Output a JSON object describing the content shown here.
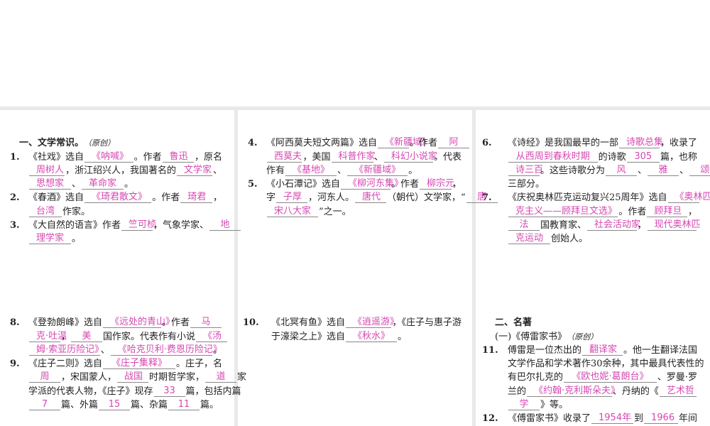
{
  "accent_color": "#d548b2",
  "panels": [
    {
      "lines": [
        [
          {
            "t": "一、文学常识。",
            "h": 1
          },
          {
            "t": "（原创）",
            "i": 1
          }
        ],
        [
          {
            "t": "1.",
            "n": 1
          },
          {
            "t": "《社戏》选自"
          },
          {
            "t": "《呐喊》",
            "b": 1
          },
          {
            "t": "。作者"
          },
          {
            "t": "鲁迅",
            "b": 1
          },
          {
            "t": "，原名"
          }
        ],
        [
          {
            "t": "周树人",
            "b": 1
          },
          {
            "t": "，浙江绍兴人，我国著名的"
          },
          {
            "t": "文学家",
            "b": 1
          },
          {
            "t": "、"
          }
        ],
        [
          {
            "t": "思想家",
            "b": 1
          },
          {
            "t": "、"
          },
          {
            "t": "革命家",
            "b": 1
          },
          {
            "t": "。"
          }
        ],
        [
          {
            "t": "2.",
            "n": 1
          },
          {
            "t": "《春酒》选自"
          },
          {
            "t": "《琦君散文》",
            "b": 1
          },
          {
            "t": "。作者"
          },
          {
            "t": "琦君",
            "b": 1
          },
          {
            "t": "，"
          }
        ],
        [
          {
            "t": "台湾",
            "b": 1
          },
          {
            "t": "作家。"
          }
        ],
        [
          {
            "t": "3.",
            "n": 1
          },
          {
            "t": "《大自然的语言》作者"
          },
          {
            "t": "竺可桢",
            "b": 1
          },
          {
            "t": "，气象学家、"
          },
          {
            "t": "地",
            "b": 1
          }
        ],
        [
          {
            "t": "理学家",
            "b": 1
          },
          {
            "t": "。"
          }
        ]
      ]
    },
    {
      "lines": [
        [
          {
            "t": "4.",
            "n": 1
          },
          {
            "t": "《阿西莫夫短文两篇》选自"
          },
          {
            "t": "《新疆域》",
            "b": 1
          },
          {
            "t": "。作者"
          },
          {
            "t": "阿",
            "b": 1
          }
        ],
        [
          {
            "t": "西莫夫",
            "b": 1
          },
          {
            "t": "，美国"
          },
          {
            "t": "科普作家",
            "b": 1
          },
          {
            "t": "、"
          },
          {
            "t": "科幻小说家",
            "b": 1
          },
          {
            "t": "。代表"
          }
        ],
        [
          {
            "t": "作有"
          },
          {
            "t": "《基地》",
            "b": 1
          },
          {
            "t": "、"
          },
          {
            "t": "《新疆域》",
            "b": 1
          },
          {
            "t": "。"
          }
        ],
        [
          {
            "t": "5.",
            "n": 1
          },
          {
            "t": "《小石潭记》选自"
          },
          {
            "t": "《柳河东集》",
            "b": 1
          },
          {
            "t": "。作者"
          },
          {
            "t": "柳宗元",
            "b": 1
          },
          {
            "t": "，"
          }
        ],
        [
          {
            "t": "字"
          },
          {
            "t": "子厚",
            "b": 1
          },
          {
            "t": "，河东人。"
          },
          {
            "t": "唐代",
            "b": 1
          },
          {
            "t": "（朝代）文学家，“"
          },
          {
            "t": "唐",
            "b": 1
          }
        ],
        [
          {
            "t": "宋八大家",
            "b": 1
          },
          {
            "t": "”之一。"
          }
        ]
      ]
    },
    {
      "lines": [
        [
          {
            "t": "6.",
            "n": 1
          },
          {
            "t": "《诗经》是我国最早的一部"
          },
          {
            "t": "诗歌总集",
            "b": 1
          },
          {
            "t": "，收录了"
          }
        ],
        [
          {
            "t": "从西周到春秋时期",
            "b": 1
          },
          {
            "t": "的诗歌"
          },
          {
            "t": "305",
            "b": 1
          },
          {
            "t": "篇，也称"
          }
        ],
        [
          {
            "t": "诗三百",
            "b": 1
          },
          {
            "t": "。这些诗歌分为"
          },
          {
            "t": "风",
            "b": 1
          },
          {
            "t": "、"
          },
          {
            "t": "雅",
            "b": 1
          },
          {
            "t": "、"
          },
          {
            "t": "颂",
            "b": 1
          }
        ],
        [
          {
            "t": "三部分。"
          }
        ],
        [
          {
            "t": "7.",
            "n": 1
          },
          {
            "t": "《庆祝奥林匹克运动复兴25周年》选自"
          },
          {
            "t": "《奥林匹",
            "b": 1
          }
        ],
        [
          {
            "t": "克主义——顾拜旦文选》",
            "b": 1
          },
          {
            "t": "。作者"
          },
          {
            "t": "顾拜旦",
            "b": 1
          },
          {
            "t": "，"
          }
        ],
        [
          {
            "t": "法",
            "b": 1
          },
          {
            "t": "国教育家、"
          },
          {
            "t": "社会活动家",
            "b": 1
          },
          {
            "t": "，"
          },
          {
            "t": "现代奥林匹",
            "b": 1
          }
        ],
        [
          {
            "t": "克运动",
            "b": 1
          },
          {
            "t": "创始人。"
          }
        ]
      ]
    },
    {
      "lines": [
        [
          {
            "t": "8.",
            "n": 1
          },
          {
            "t": "《登勃朗峰》选自"
          },
          {
            "t": "《远处的青山》",
            "b": 1
          },
          {
            "t": "。作者"
          },
          {
            "t": "马",
            "b": 1
          }
        ],
        [
          {
            "t": "克·吐温",
            "b": 1
          },
          {
            "t": "，"
          },
          {
            "t": "美",
            "b": 1
          },
          {
            "t": "国作家。代表作有小说"
          },
          {
            "t": "《汤",
            "b": 1
          }
        ],
        [
          {
            "t": "姆·索亚历险记》",
            "b": 1
          },
          {
            "t": "、"
          },
          {
            "t": "《哈克贝利·费恩历险记》",
            "b": 1
          },
          {
            "t": "。"
          }
        ],
        [
          {
            "t": "9.",
            "n": 1
          },
          {
            "t": "《庄子二则》选自"
          },
          {
            "t": "《庄子集释》",
            "b": 1
          },
          {
            "t": "。庄子，名"
          }
        ],
        [
          {
            "t": "周",
            "b": 1
          },
          {
            "t": "，宋国蒙人，"
          },
          {
            "t": "战国",
            "b": 1
          },
          {
            "t": "时期哲学家，"
          },
          {
            "t": "道",
            "b": 1
          },
          {
            "t": "家"
          }
        ],
        [
          {
            "t": "学派的代表人物，《庄子》现存"
          },
          {
            "t": "33",
            "b": 1
          },
          {
            "t": "篇，包括内篇"
          }
        ],
        [
          {
            "t": "7",
            "b": 1
          },
          {
            "t": "篇、外篇"
          },
          {
            "t": "15",
            "b": 1
          },
          {
            "t": "篇、杂篇"
          },
          {
            "t": "11",
            "b": 1
          },
          {
            "t": "篇。"
          }
        ]
      ]
    },
    {
      "lines": [
        [
          {
            "t": "10.",
            "n": 1
          },
          {
            "t": "《北冥有鱼》选自"
          },
          {
            "t": "《逍遥游》",
            "b": 1
          },
          {
            "t": "，《庄子与惠子游"
          }
        ],
        [
          {
            "t": "于濠梁之上》选自"
          },
          {
            "t": "《秋水》",
            "b": 1
          },
          {
            "t": "。"
          }
        ]
      ]
    },
    {
      "lines": [
        [
          {
            "t": "二、名著",
            "h": 1
          }
        ],
        [
          {
            "t": "(一)《傅雷家书》"
          },
          {
            "t": "（原创）",
            "i": 1
          }
        ],
        [
          {
            "t": "11.",
            "n": 1
          },
          {
            "t": "傅雷是一位杰出的"
          },
          {
            "t": "翻译家",
            "b": 1
          },
          {
            "t": "。他一生翻译法国"
          }
        ],
        [
          {
            "t": "文学作品和学术著作30余种，其中最具代表性的"
          }
        ],
        [
          {
            "t": "有巴尔扎克的"
          },
          {
            "t": "《欧也妮·葛朗台》",
            "b": 1
          },
          {
            "t": "、罗曼·罗"
          }
        ],
        [
          {
            "t": "兰的"
          },
          {
            "t": "《约翰·克利斯朵夫》",
            "b": 1
          },
          {
            "t": "、丹纳的《"
          },
          {
            "t": "艺术哲",
            "b": 1
          }
        ],
        [
          {
            "t": "学",
            "b": 1
          },
          {
            "t": "》等。"
          }
        ],
        [
          {
            "t": "12.",
            "n": 1
          },
          {
            "t": "《傅雷家书》收录了"
          },
          {
            "t": "1954年",
            "b": 1
          },
          {
            "t": "到"
          },
          {
            "t": "1966",
            "b": 1
          },
          {
            "t": "年间"
          }
        ]
      ]
    }
  ]
}
